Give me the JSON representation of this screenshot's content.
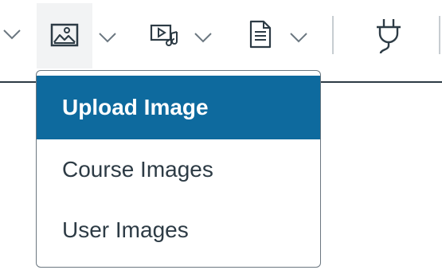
{
  "toolbar": {
    "buttons": [
      {
        "icon": "chevron-down-icon"
      },
      {
        "icon": "image-icon",
        "menu_icon": "chevron-down-icon"
      },
      {
        "icon": "media-icon",
        "menu_icon": "chevron-down-icon"
      },
      {
        "icon": "document-icon",
        "menu_icon": "chevron-down-icon"
      },
      {
        "icon": "plug-icon"
      }
    ]
  },
  "image_menu": {
    "items": [
      {
        "label": "Upload Image",
        "selected": true
      },
      {
        "label": "Course Images",
        "selected": false
      },
      {
        "label": "User Images",
        "selected": false
      }
    ]
  },
  "colors": {
    "highlight": "#0e6a9e",
    "text": "#2d3b45",
    "toolbar_border": "#2d3b45",
    "icon": "#2d3b45"
  }
}
